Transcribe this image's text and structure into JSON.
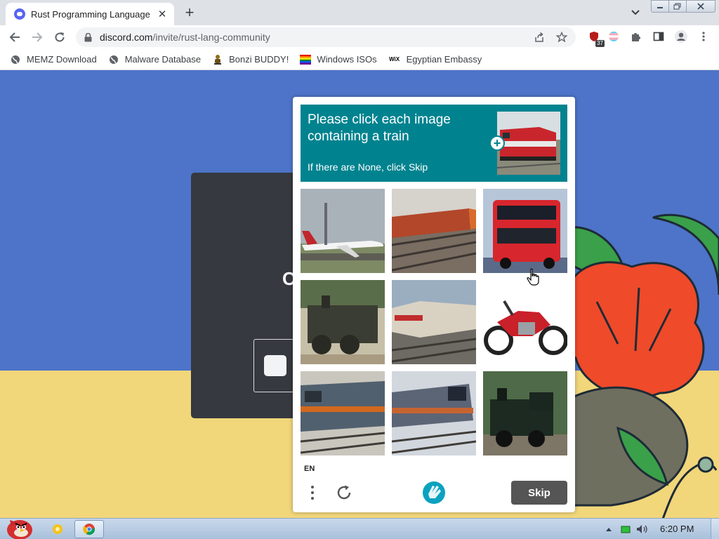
{
  "browser": {
    "tab": {
      "title": "Rust Programming Language",
      "close_glyph": "✕"
    },
    "new_tab_glyph": "+",
    "address_bar": {
      "domain": "discord.com",
      "path": "/invite/rust-lang-community"
    },
    "extension_badge": "37",
    "bookmarks": [
      {
        "label": "MEMZ Download",
        "icon": "globe-icon"
      },
      {
        "label": "Malware Database",
        "icon": "globe-icon"
      },
      {
        "label": "Bonzi BUDDY!",
        "icon": "bonzi-icon"
      },
      {
        "label": "Windows ISOs",
        "icon": "rainbow-flag-icon"
      },
      {
        "label": "Egyptian Embassy",
        "icon": "wix-icon"
      }
    ],
    "wix_text": "WiX"
  },
  "page": {
    "background_letter": "C"
  },
  "captcha": {
    "prompt_title": "Please click each image containing a train",
    "prompt_subtitle": "If there are None, click Skip",
    "plus_glyph": "+",
    "language": "EN",
    "skip_label": "Skip",
    "tiles": [
      {
        "subject": "airplane"
      },
      {
        "subject": "train"
      },
      {
        "subject": "bus"
      },
      {
        "subject": "train"
      },
      {
        "subject": "train"
      },
      {
        "subject": "motorcycle"
      },
      {
        "subject": "train"
      },
      {
        "subject": "train"
      },
      {
        "subject": "train"
      }
    ],
    "colors": {
      "prompt_bg": "#00838f",
      "skip_bg": "#555555"
    }
  },
  "taskbar": {
    "clock": "6:20 PM"
  }
}
